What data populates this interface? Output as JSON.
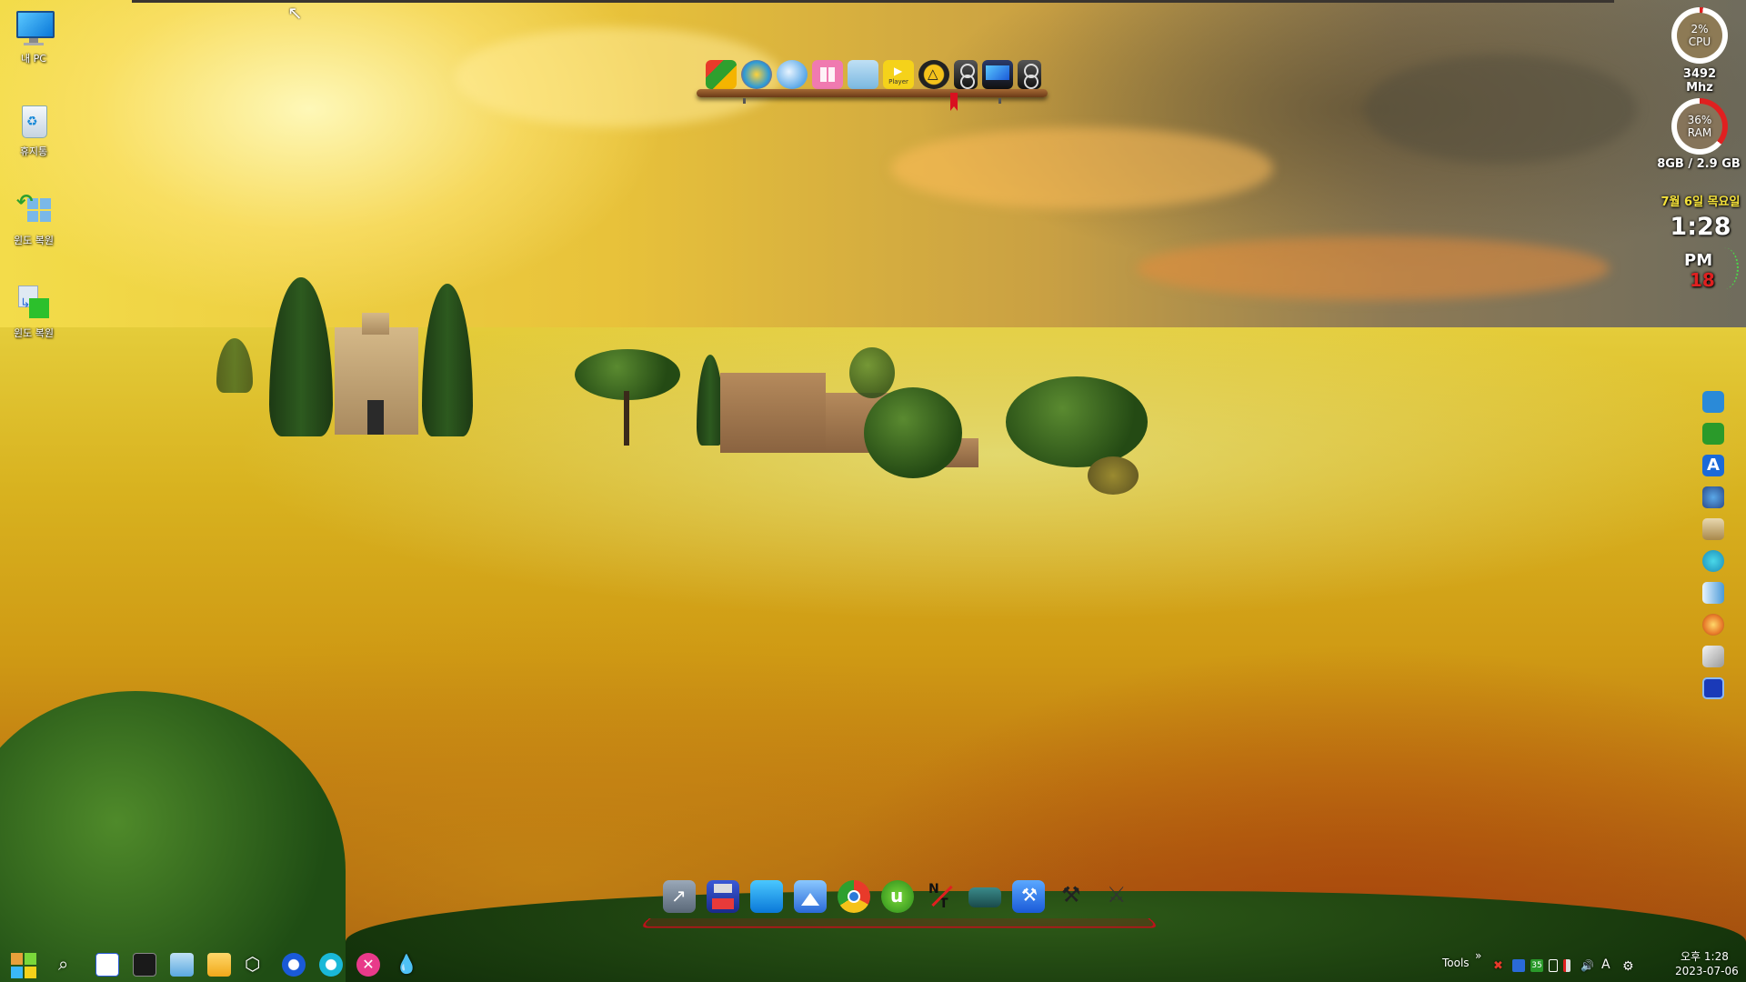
{
  "desktop": {
    "icons": [
      {
        "label": "내 PC",
        "icon": "monitor-icon"
      },
      {
        "label": "휴지통",
        "icon": "recycle-bin-icon"
      },
      {
        "label": "윈도 복원",
        "icon": "windows-restore-icon"
      },
      {
        "label": "윈도 복원",
        "icon": "windows-restore-icon"
      }
    ]
  },
  "top_dock": {
    "icons": [
      "system-manager-icon",
      "disk-icon",
      "search-tool-icon",
      "windows-logo-icon",
      "file-icon",
      "player-icon",
      "aimp-icon",
      "speaker-icon",
      "monitor-display-icon",
      "speaker-icon"
    ],
    "player_label": "Player"
  },
  "widgets": {
    "cpu": {
      "percent": "2%",
      "label": "CPU",
      "freq": "3492 Mhz",
      "value": 0.02
    },
    "ram": {
      "percent": "36%",
      "label": "RAM",
      "usage": "8GB /  2.9 GB",
      "value": 0.36
    },
    "clock": {
      "date": "7월 6일 목요일",
      "time": "1:28",
      "ampm": "PM",
      "seconds": "18"
    }
  },
  "right_bar": {
    "icons": [
      "refresh-icon",
      "drive-icon",
      "font-a-icon",
      "network-icon",
      "disk-tool-icon",
      "gear-chain-icon",
      "arrow-icon",
      "cd-icon",
      "eraser-icon",
      "chip-icon"
    ]
  },
  "bottom_dock": {
    "icons": [
      "rocket-icon",
      "floppy-save-icon",
      "window-icon",
      "image-viewer-icon",
      "chrome-icon",
      "utorrent-icon",
      "notepad-icon",
      "ram-module-icon",
      "wrench-icon",
      "tools-icon",
      "key-tools-icon"
    ]
  },
  "taskbar": {
    "start": "start-icon",
    "apps": [
      "search-icon",
      "task-manager-icon",
      "terminal-icon",
      "file-icon",
      "folder-icon",
      "package-icon",
      "power-icon",
      "sync-icon",
      "close-x-icon",
      "drop-icon"
    ],
    "tools_label": "Tools",
    "chevron": "»",
    "tray_badge": "35",
    "ime": "A",
    "time": "오후 1:28",
    "date": "2023-07-06"
  },
  "colors": {
    "accent_red": "#d91020",
    "clock_yellow": "#f5e23a",
    "seconds_red": "#e02020"
  }
}
